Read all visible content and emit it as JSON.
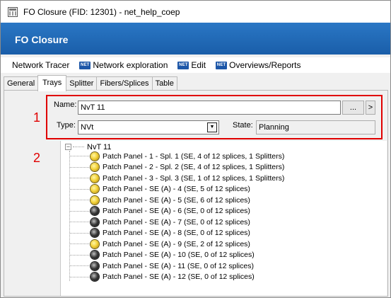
{
  "window": {
    "title": "FO Closure (FID: 12301) - net_help_coep"
  },
  "header": {
    "title": "FO Closure"
  },
  "menu": {
    "items": [
      {
        "label": "Network Tracer",
        "badge": ""
      },
      {
        "label": "Network exploration",
        "badge": "NET"
      },
      {
        "label": "Edit",
        "badge": "NET"
      },
      {
        "label": "Overviews/Reports",
        "badge": "NET"
      }
    ]
  },
  "tabs": [
    {
      "label": "General"
    },
    {
      "label": "Trays",
      "active": true
    },
    {
      "label": "Splitter"
    },
    {
      "label": "Fibers/Splices"
    },
    {
      "label": "Table"
    }
  ],
  "annotations": {
    "first": "1",
    "second": "2"
  },
  "form": {
    "name_label": "Name:",
    "name_value": "NvT 11",
    "browse_label": "...",
    "next_label": ">",
    "type_label": "Type:",
    "type_value": "NVt",
    "state_label": "State:",
    "state_value": "Planning"
  },
  "tree": {
    "root_expander": "−",
    "root_label": "NvT 11",
    "items": [
      {
        "label": "Patch Panel - 1 - Spl. 1 (SE, 4 of 12 splices, 1 Splitters)",
        "status": "yellow"
      },
      {
        "label": "Patch Panel - 2 - Spl. 2 (SE, 4 of 12 splices, 1 Splitters)",
        "status": "yellow"
      },
      {
        "label": "Patch Panel - 3 - Spl. 3 (SE, 1 of 12 splices, 1 Splitters)",
        "status": "yellow"
      },
      {
        "label": "Patch Panel - SE (A) - 4 (SE, 5 of 12 splices)",
        "status": "yellow"
      },
      {
        "label": "Patch Panel - SE (A) - 5 (SE, 6 of 12 splices)",
        "status": "yellow"
      },
      {
        "label": "Patch Panel - SE (A) - 6 (SE, 0 of 12 splices)",
        "status": "dark"
      },
      {
        "label": "Patch Panel - SE (A) - 7 (SE, 0 of 12 splices)",
        "status": "dark"
      },
      {
        "label": "Patch Panel - SE (A) - 8 (SE, 0 of 12 splices)",
        "status": "dark"
      },
      {
        "label": "Patch Panel - SE (A) - 9 (SE, 2 of 12 splices)",
        "status": "yellow"
      },
      {
        "label": "Patch Panel - SE (A) - 10 (SE, 0 of 12 splices)",
        "status": "dark"
      },
      {
        "label": "Patch Panel - SE (A) - 11 (SE, 0 of 12 splices)",
        "status": "dark"
      },
      {
        "label": "Patch Panel - SE (A) - 12 (SE, 0 of 12 splices)",
        "status": "dark"
      }
    ]
  },
  "colors": {
    "header_blue": "#1f66b3",
    "annotation_red": "#e00000",
    "status_yellow": "#f3d23a",
    "status_dark": "#2a2a2a"
  }
}
